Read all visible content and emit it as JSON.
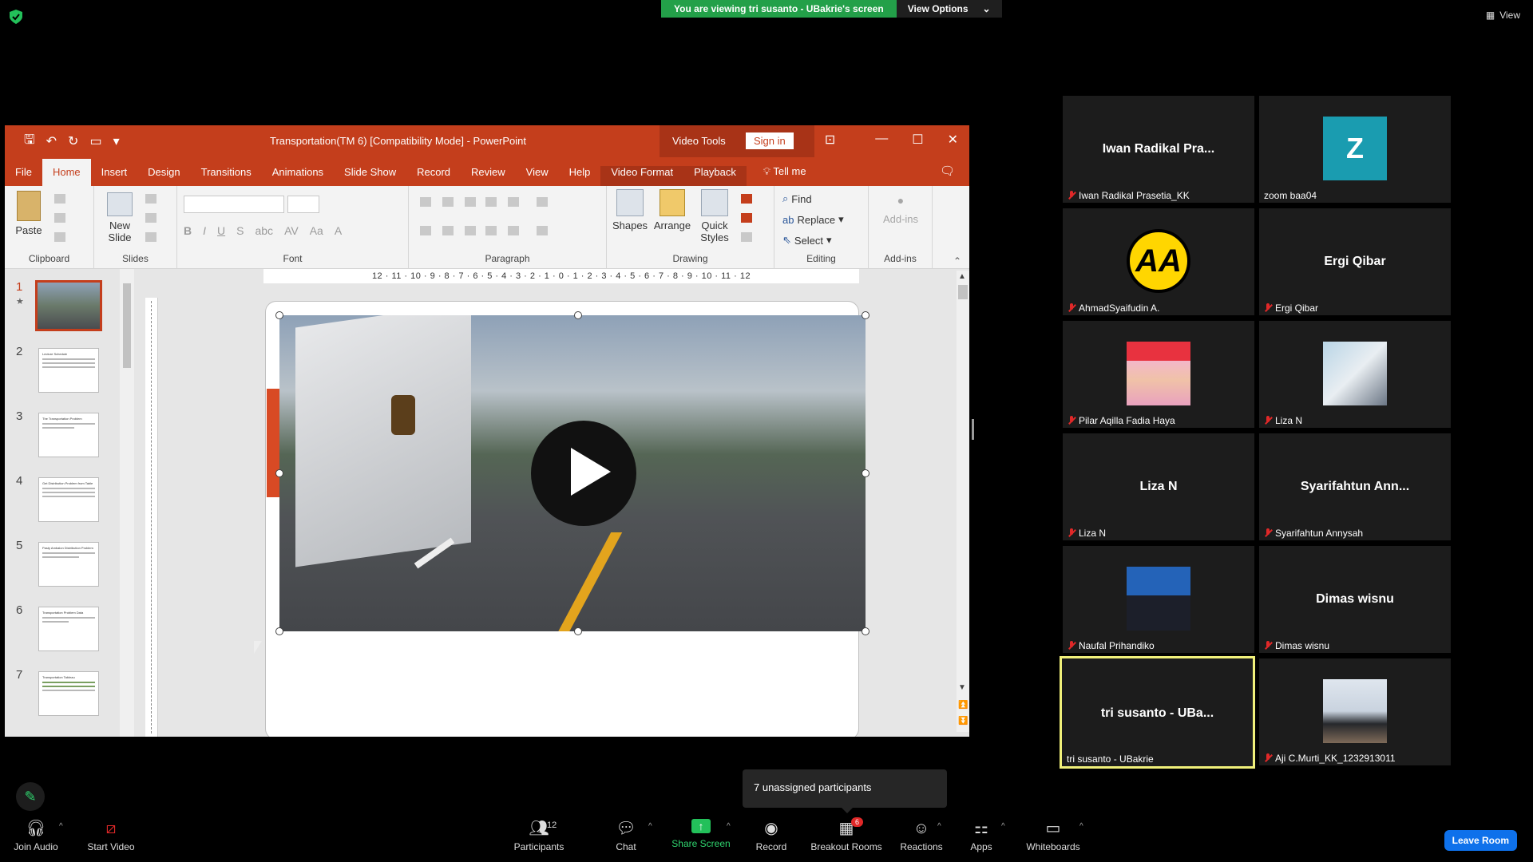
{
  "top_bar": {
    "viewing_text": "You are viewing tri susanto - UBakrie's screen",
    "view_options": "View Options",
    "view": "View"
  },
  "ppt": {
    "title": "Transportation(TM 6) [Compatibility Mode]  -  PowerPoint",
    "video_tools": "Video Tools",
    "sign_in": "Sign in",
    "tabs": [
      "File",
      "Home",
      "Insert",
      "Design",
      "Transitions",
      "Animations",
      "Slide Show",
      "Record",
      "Review",
      "View",
      "Help",
      "Video Format",
      "Playback"
    ],
    "tell_me": "Tell me",
    "ribbon": {
      "paste": "Paste",
      "new_slide": "New Slide",
      "shapes": "Shapes",
      "arrange": "Arrange",
      "quick_styles": "Quick Styles",
      "find": "Find",
      "replace": "Replace",
      "select": "Select",
      "add_ins": "Add-ins",
      "groups": [
        "Clipboard",
        "Slides",
        "Font",
        "Paragraph",
        "Drawing",
        "Editing",
        "Add-ins"
      ]
    },
    "ruler_text": "12 · 11 · 10 · 9 · 8 · 7 · 6 · 5 · 4 · 3 · 2 · 1 · 0 · 1 · 2 · 3 · 4 · 5 · 6 · 7 · 8 · 9 · 10 · 11 · 12",
    "slides": [
      {
        "num": "1",
        "title": ""
      },
      {
        "num": "2",
        "title": "Lecture Schedule"
      },
      {
        "num": "3",
        "title": "The Transportation Problem"
      },
      {
        "num": "4",
        "title": "Get Distribution Problem from Table"
      },
      {
        "num": "5",
        "title": "Pasty Ambalon Distribution Problem"
      },
      {
        "num": "6",
        "title": "Transportation Problem Data"
      },
      {
        "num": "7",
        "title": "Transportation Tableau"
      }
    ]
  },
  "participants": [
    {
      "display": "Iwan Radikal Pra...",
      "label": "Iwan Radikal Prasetia_KK",
      "muted": true
    },
    {
      "display": "Z",
      "label": "zoom baa04",
      "muted": false
    },
    {
      "display": "AA",
      "label": "AhmadSyaifudin A.",
      "muted": true
    },
    {
      "display": "Ergi Qibar",
      "label": "Ergi Qibar",
      "muted": true
    },
    {
      "display": "",
      "label": "Pilar Aqilla Fadia Haya",
      "muted": true
    },
    {
      "display": "",
      "label": "Liza N",
      "muted": true
    },
    {
      "display": "Liza N",
      "label": "Liza N",
      "muted": true
    },
    {
      "display": "Syarifahtun  Ann...",
      "label": "Syarifahtun Annysah",
      "muted": true
    },
    {
      "display": "",
      "label": "Naufal Prihandiko",
      "muted": true
    },
    {
      "display": "Dimas wisnu",
      "label": "Dimas wisnu",
      "muted": true
    },
    {
      "display": "tri susanto - UBa...",
      "label": "tri susanto - UBakrie",
      "muted": false
    },
    {
      "display": "",
      "label": "Aji C.Murti_KK_1232913011",
      "muted": true
    }
  ],
  "popup": {
    "unassigned": "7 unassigned participants"
  },
  "toolbar": {
    "join_audio": "Join Audio",
    "start_video": "Start Video",
    "participants": "Participants",
    "participants_count": "12",
    "chat": "Chat",
    "share_screen": "Share Screen",
    "record": "Record",
    "breakout_rooms": "Breakout Rooms",
    "breakout_badge": "6",
    "reactions": "Reactions",
    "apps": "Apps",
    "whiteboards": "Whiteboards",
    "leave_room": "Leave Room"
  },
  "colors": {
    "ppt_accent": "#c43e1c",
    "share_green": "#23c05a",
    "leave_blue": "#0e71eb",
    "active_speaker": "#f0f07a"
  }
}
